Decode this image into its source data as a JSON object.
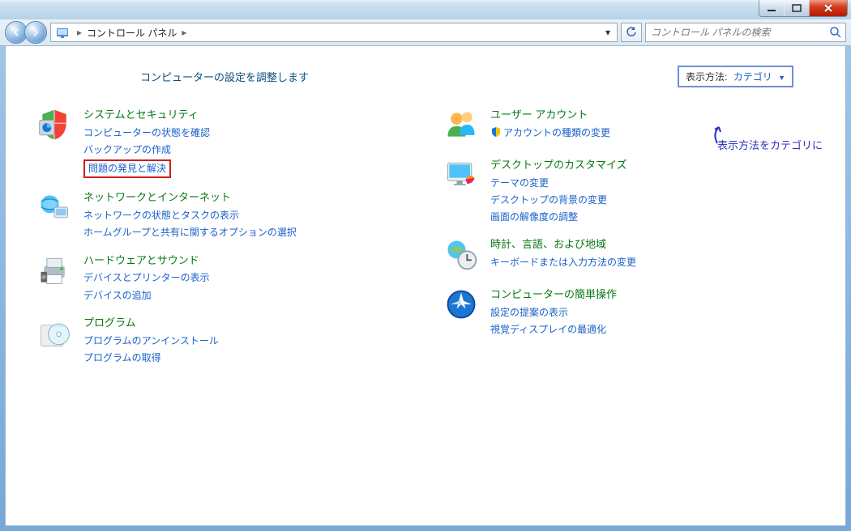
{
  "window": {
    "title": "コントロール パネル"
  },
  "breadcrumb": {
    "root": "コントロール パネル"
  },
  "search": {
    "placeholder": "コントロール パネルの検索"
  },
  "heading": "コンピューターの設定を調整します",
  "viewBy": {
    "label": "表示方法:",
    "value": "カテゴリ"
  },
  "annotation": "表示方法をカテゴリに",
  "leftCategories": [
    {
      "icon": "shield-icon",
      "title": "システムとセキュリティ",
      "links": [
        {
          "text": "コンピューターの状態を確認",
          "highlight": false
        },
        {
          "text": "バックアップの作成",
          "highlight": false
        },
        {
          "text": "問題の発見と解決",
          "highlight": true
        }
      ]
    },
    {
      "icon": "globe-network-icon",
      "title": "ネットワークとインターネット",
      "links": [
        {
          "text": "ネットワークの状態とタスクの表示",
          "highlight": false
        },
        {
          "text": "ホームグループと共有に関するオプションの選択",
          "highlight": false
        }
      ]
    },
    {
      "icon": "printer-icon",
      "title": "ハードウェアとサウンド",
      "links": [
        {
          "text": "デバイスとプリンターの表示",
          "highlight": false
        },
        {
          "text": "デバイスの追加",
          "highlight": false
        }
      ]
    },
    {
      "icon": "disc-icon",
      "title": "プログラム",
      "links": [
        {
          "text": "プログラムのアンインストール",
          "highlight": false
        },
        {
          "text": "プログラムの取得",
          "highlight": false
        }
      ]
    }
  ],
  "rightCategories": [
    {
      "icon": "users-icon",
      "title": "ユーザー アカウント",
      "links": [
        {
          "text": "アカウントの種類の変更",
          "highlight": false,
          "shield": true
        }
      ]
    },
    {
      "icon": "appearance-icon",
      "title": "デスクトップのカスタマイズ",
      "links": [
        {
          "text": "テーマの変更",
          "highlight": false
        },
        {
          "text": "デスクトップの背景の変更",
          "highlight": false
        },
        {
          "text": "画面の解像度の調整",
          "highlight": false
        }
      ]
    },
    {
      "icon": "clock-globe-icon",
      "title": "時計、言語、および地域",
      "links": [
        {
          "text": "キーボードまたは入力方法の変更",
          "highlight": false
        }
      ]
    },
    {
      "icon": "ease-of-access-icon",
      "title": "コンピューターの簡単操作",
      "links": [
        {
          "text": "設定の提案の表示",
          "highlight": false
        },
        {
          "text": "視覚ディスプレイの最適化",
          "highlight": false
        }
      ]
    }
  ]
}
